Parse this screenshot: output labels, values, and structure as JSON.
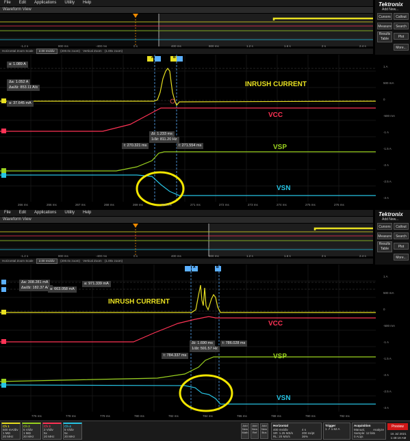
{
  "menu": [
    "File",
    "Edit",
    "Applications",
    "Utility",
    "Help"
  ],
  "window": {
    "title": "Waveform View"
  },
  "brand": {
    "name": "Tektronix",
    "add_new": "Add New..."
  },
  "side_buttons": {
    "cursors": "Cursors",
    "callout": "Callout",
    "measure": "Measure",
    "search": "Search",
    "results": "Results Table",
    "plot": "Plot",
    "more": "More..."
  },
  "zoom_bar": {
    "hz_label": "Horizontal Zoom Scale",
    "hz_value": "2.00 ms/div",
    "hz_zoom": "(200.0x zoom)",
    "vz_label": "Vertical Zoom",
    "vz_value": "(1.00x zoom)"
  },
  "overview_right_ticks": [
    "-1.4",
    "-2.4",
    "-1.4",
    "-2.4",
    "-2.5",
    "-3.1"
  ],
  "top": {
    "overview_ticks": [
      "-1.2 s",
      "800 ms",
      "-400 ms",
      "0 s",
      "400 ms",
      "800 ms",
      "1.2 s",
      "1.6 s",
      "2 s",
      "2.4 s"
    ],
    "cursor_a": "A",
    "cursor_b": "B",
    "readouts": {
      "a1": "a: 1.089 A",
      "delta": "Δa: 1.052 A",
      "rate": "Δa/Δt: 853.11 A/s",
      "a2": "a: 37.645 mA",
      "dt": "Δt: 1.233 ms",
      "inv": "1/Δt: 811.20 Hz",
      "t1": "t: 270.321 ms",
      "t2": "t: 271.554 ms"
    },
    "annotations": {
      "inrush": "INRUSH CURRENT",
      "vcc": "VCC",
      "vsp": "VSP",
      "vsn": "VSN"
    },
    "right_ticks": [
      "1 A",
      "500 mA",
      "0",
      "-500 mA",
      "-1 A",
      "-1.5 A",
      "-2 A",
      "-2.5 A",
      "-3 A"
    ],
    "time_ticks": [
      "266 ms",
      "266 ms",
      "267 ms",
      "268 ms",
      "269 ms",
      "270 ms",
      "271 ms",
      "272 ms",
      "273 ms",
      "274 ms",
      "275 ms",
      "276 ms",
      "277 ms"
    ]
  },
  "bottom": {
    "overview_ticks": [
      "-1.2 s",
      "800 ms",
      "-400 ms",
      "0 s",
      "400 ms",
      "800 ms",
      "1.2 s",
      "1.6 s",
      "2 s",
      "2.4 s"
    ],
    "cursor_a": "A",
    "cursor_b": "B",
    "readouts": {
      "delta": "Δa: 308.281 mA",
      "rate": "Δa/Δt: 182.37 A/s",
      "a1": "a: 971.339 mA",
      "a2": "a: 663.058 mA",
      "dt": "Δt: 1.690 ms",
      "inv": "1/Δt: 591.57 Hz",
      "t1": "t: 784.337 ms",
      "t2": "t: 786.028 ms"
    },
    "annotations": {
      "inrush": "INRUSH CURRENT",
      "vcc": "VCC",
      "vsp": "VSP",
      "vsn": "VSN"
    },
    "right_ticks": [
      "1 A",
      "500 mA",
      "0",
      "-500 mA",
      "-1 A",
      "-1.5 A",
      "-2 A",
      "-2.5 A",
      "-3 A"
    ],
    "time_ticks": [
      "776 ms",
      "778 ms",
      "779 ms",
      "780 ms",
      "782 ms",
      "784 ms",
      "786 ms",
      "788 ms",
      "790 ms",
      "792 ms"
    ]
  },
  "statusbar": {
    "ch1": {
      "name": "Ch 1",
      "v1": "500 mA/div",
      "v2": "1 MΩ",
      "v3": "20 MHz"
    },
    "ch2": {
      "name": "Ch 2",
      "v1": "5 V/div",
      "v2": "1 MΩ",
      "v3": "20 MHz"
    },
    "ch3": {
      "name": "Ch 3",
      "v1": "2 V/div",
      "v2": "5x",
      "v3": "20 MHz"
    },
    "ch4": {
      "name": "Ch 4",
      "v1": "5 V/div",
      "v2": "5x",
      "v3": "20 MHz"
    },
    "add_buttons": [
      "Add New Math",
      "Add New Ref",
      "Add New Bus"
    ],
    "horizontal": {
      "title": "Horizontal",
      "l1": "400 ms/div",
      "l2": "SR: 1.25 MS/s",
      "l3": "RL: 20 MS/s",
      "r1": "4 s",
      "r2": "200 ns/pt",
      "r3": "36%"
    },
    "trigger": {
      "title": "Trigger",
      "l1": "1 ↗ 1.52 A"
    },
    "acquisition": {
      "title": "Acquisition",
      "l1": "Manual,",
      "l2": "Sample: 12 bits",
      "l3": "0 Acqs",
      "r1": "Analyze"
    },
    "preview": "Preview",
    "date": "16 Jul 2021",
    "time": "1:48:19 AM"
  },
  "colors": {
    "yellow": "#e8e021",
    "red": "#ff3355",
    "green": "#9bd21f",
    "cyan": "#27c4e4",
    "orange": "#f08a00",
    "cursor": "#5bb0ff"
  }
}
